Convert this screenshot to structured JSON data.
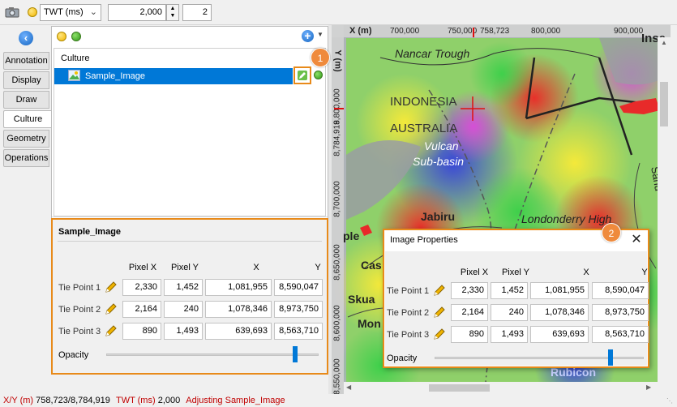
{
  "toolbar": {
    "domain_label": "TWT (ms)",
    "value": "2,000",
    "step": "2"
  },
  "side_tabs": [
    "Annotation",
    "Display",
    "Draw",
    "Culture",
    "Geometry",
    "Operations"
  ],
  "culture_panel": {
    "list_header": "Culture",
    "item_label": "Sample_Image",
    "section_title": "Sample_Image",
    "columns": [
      "Pixel X",
      "Pixel Y",
      "X",
      "Y"
    ],
    "rows": [
      {
        "label": "Tie Point 1",
        "px": "2,330",
        "py": "1,452",
        "x": "1,081,955",
        "y": "8,590,047"
      },
      {
        "label": "Tie Point 2",
        "px": "2,164",
        "py": "240",
        "x": "1,078,346",
        "y": "8,973,750"
      },
      {
        "label": "Tie Point 3",
        "px": "890",
        "py": "1,493",
        "x": "639,693",
        "y": "8,563,710"
      }
    ],
    "opacity_label": "Opacity",
    "opacity_value": 0.9
  },
  "badges": [
    "1",
    "2"
  ],
  "map": {
    "x_axis_label": "X (m)",
    "x_ticks": [
      "700,000",
      "750,000",
      "758,723",
      "800,000",
      "900,000"
    ],
    "y_axis_label": "Y (m)",
    "y_ticks": [
      "8,800,000",
      "8,784,919",
      "8,700,000",
      "8,650,000",
      "8,600,000",
      "8,550,000"
    ],
    "labels": [
      "Nancar Trough",
      "INDONESIA",
      "AUSTRALIA",
      "Vulcan",
      "Sub-basin",
      "Jabiru",
      "Londonderry High",
      "Skua",
      "Cas",
      "Mon",
      "ple",
      "Rubicon",
      "Inse",
      "Sahu"
    ]
  },
  "dialog": {
    "title": "Image Properties",
    "columns": [
      "Pixel X",
      "Pixel Y",
      "X",
      "Y"
    ],
    "rows": [
      {
        "label": "Tie Point 1",
        "px": "2,330",
        "py": "1,452",
        "x": "1,081,955",
        "y": "8,590,047"
      },
      {
        "label": "Tie Point 2",
        "px": "2,164",
        "py": "240",
        "x": "1,078,346",
        "y": "8,973,750"
      },
      {
        "label": "Tie Point 3",
        "px": "890",
        "py": "1,493",
        "x": "639,693",
        "y": "8,563,710"
      }
    ],
    "opacity_label": "Opacity",
    "opacity_value": 0.85
  },
  "status": {
    "xy_label": "X/Y (m)",
    "xy_value": "758,723/8,784,919",
    "twt_label": "TWT (ms)",
    "twt_value": "2,000",
    "message": "Adjusting Sample_Image"
  },
  "colors": {
    "accent": "#0078d7",
    "orange": "#e88a1a",
    "status_red": "#c00000"
  }
}
